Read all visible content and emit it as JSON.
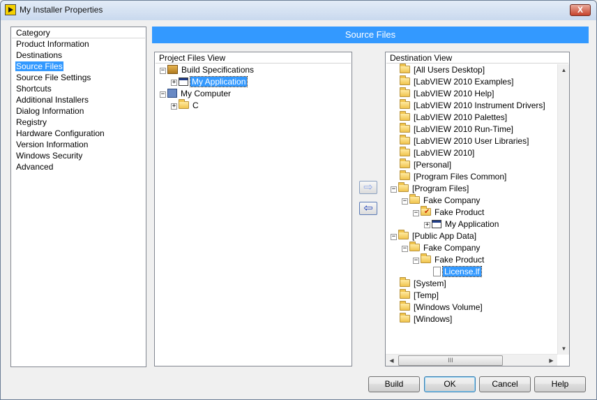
{
  "window": {
    "title": "My Installer Properties",
    "close_label": "X"
  },
  "category": {
    "header": "Category",
    "items": [
      "Product Information",
      "Destinations",
      "Source Files",
      "Source File Settings",
      "Shortcuts",
      "Additional Installers",
      "Dialog Information",
      "Registry",
      "Hardware Configuration",
      "Version Information",
      "Windows Security",
      "Advanced"
    ],
    "selected_index": 2
  },
  "banner": "Source Files",
  "project_files": {
    "header": "Project Files View",
    "nodes": [
      {
        "label": "Build Specifications",
        "icon": "build-icon",
        "expander": "minus",
        "level": 0
      },
      {
        "label": "My Application",
        "icon": "application-icon",
        "expander": "plus",
        "level": 1,
        "selected": true
      },
      {
        "label": "My Computer",
        "icon": "computer-icon",
        "expander": "minus",
        "level": 0
      },
      {
        "label": "C",
        "icon": "folder-icon",
        "expander": "plus",
        "level": 1
      }
    ]
  },
  "destination": {
    "header": "Destination View",
    "nodes": [
      {
        "label": "[All Users Desktop]",
        "level": 0
      },
      {
        "label": "[LabVIEW 2010 Examples]",
        "level": 0
      },
      {
        "label": "[LabVIEW 2010 Help]",
        "level": 0
      },
      {
        "label": "[LabVIEW 2010 Instrument Drivers]",
        "level": 0
      },
      {
        "label": "[LabVIEW 2010 Palettes]",
        "level": 0
      },
      {
        "label": "[LabVIEW 2010 Run-Time]",
        "level": 0
      },
      {
        "label": "[LabVIEW 2010 User Libraries]",
        "level": 0
      },
      {
        "label": "[LabVIEW 2010]",
        "level": 0
      },
      {
        "label": "[Personal]",
        "level": 0
      },
      {
        "label": "[Program Files Common]",
        "level": 0
      },
      {
        "label": "[Program Files]",
        "level": 0,
        "expander": "minus"
      },
      {
        "label": "Fake Company",
        "level": 1,
        "expander": "minus"
      },
      {
        "label": "Fake Product",
        "level": 2,
        "expander": "minus",
        "icon": "folder-check-icon"
      },
      {
        "label": "My Application",
        "level": 3,
        "expander": "plus",
        "icon": "application-icon"
      },
      {
        "label": "[Public App Data]",
        "level": 0,
        "expander": "minus"
      },
      {
        "label": "Fake Company",
        "level": 1,
        "expander": "minus"
      },
      {
        "label": "Fake Product",
        "level": 2,
        "expander": "minus"
      },
      {
        "label": "License.lf",
        "level": 3,
        "icon": "file-icon",
        "selected": true
      },
      {
        "label": "[System]",
        "level": 0
      },
      {
        "label": "[Temp]",
        "level": 0
      },
      {
        "label": "[Windows Volume]",
        "level": 0
      },
      {
        "label": "[Windows]",
        "level": 0
      }
    ]
  },
  "transfer": {
    "add_arrow": "⇨",
    "remove_arrow": "⇦"
  },
  "buttons": {
    "build": "Build",
    "ok": "OK",
    "cancel": "Cancel",
    "help": "Help"
  },
  "scrollbar": {
    "up": "▲",
    "down": "▼",
    "left": "◀",
    "right": "▶",
    "grip": "III"
  }
}
